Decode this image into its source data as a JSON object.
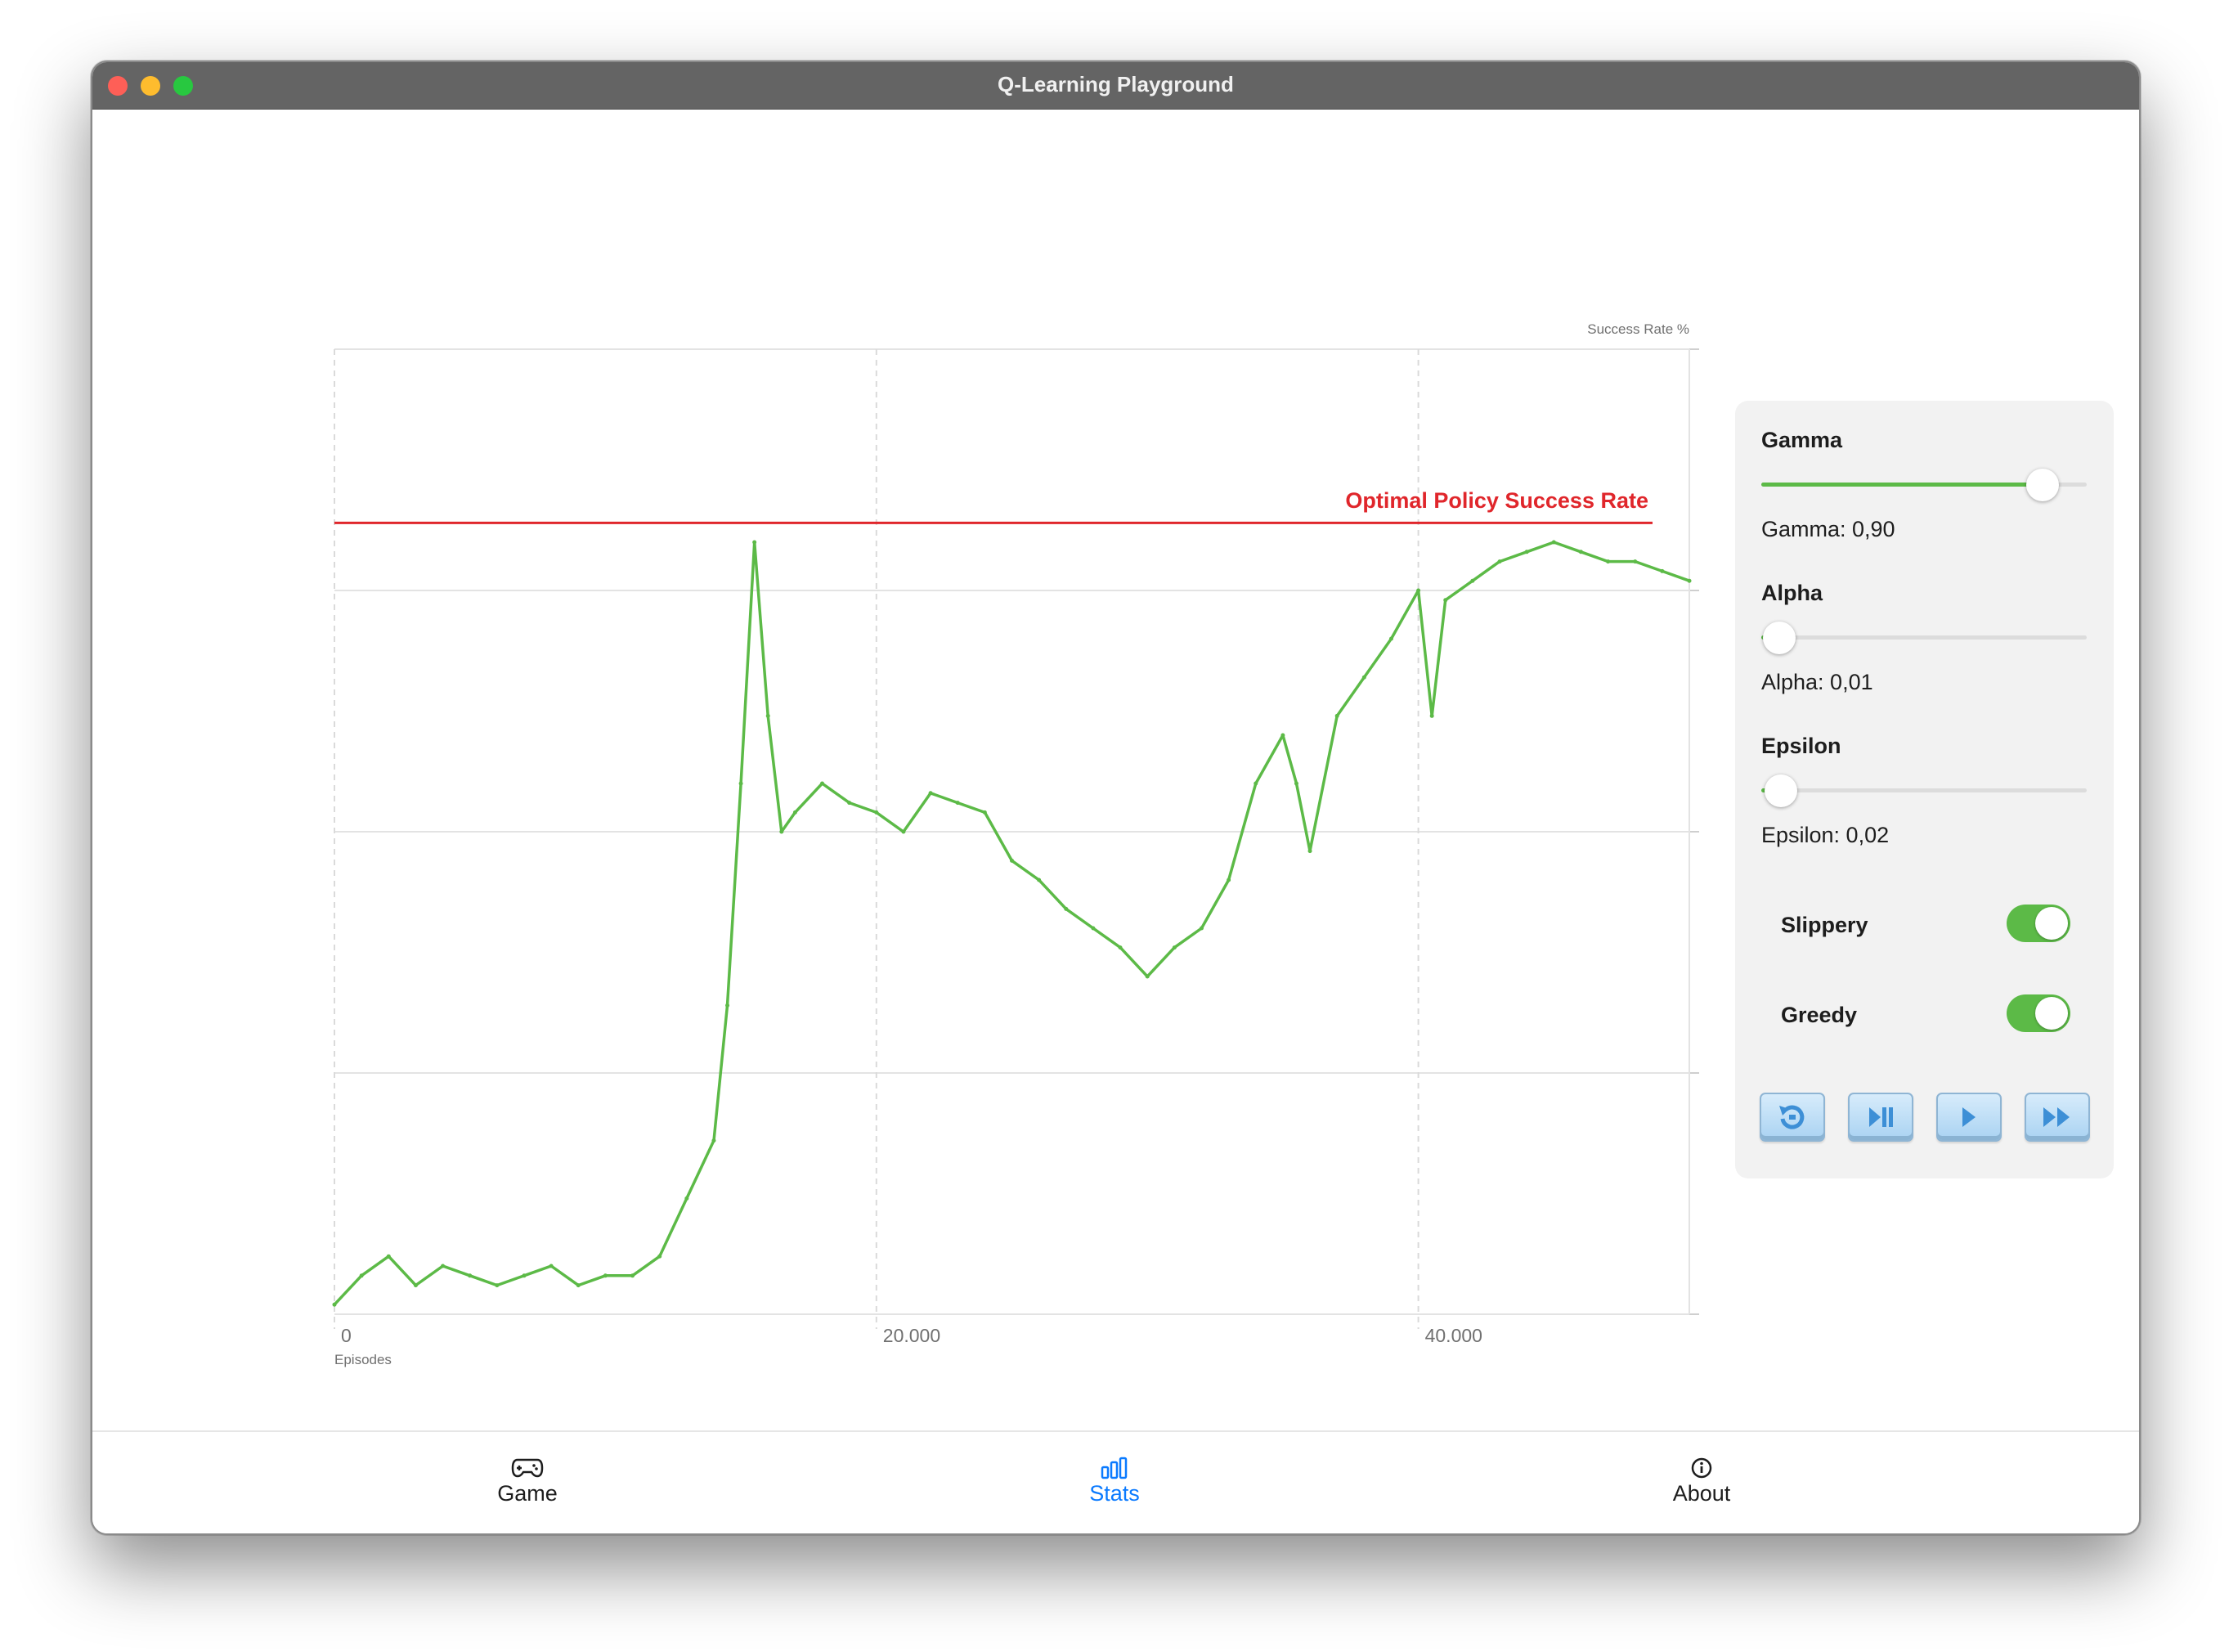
{
  "window": {
    "title": "Q-Learning Playground"
  },
  "chart_data": {
    "type": "line",
    "xlabel": "Episodes",
    "ylabel": "Success Rate %",
    "xlim": [
      0,
      50000
    ],
    "ylim": [
      0,
      100
    ],
    "x_ticks": [
      "0",
      "20.000",
      "40.000"
    ],
    "y_ticks": [
      "0",
      "25",
      "50",
      "75",
      "100"
    ],
    "grid": true,
    "reference_line": {
      "label": "Optimal Policy Success Rate",
      "y": 82,
      "color": "#e0262b"
    },
    "series": [
      {
        "color": "#5cba47",
        "x": [
          0,
          1000,
          2000,
          3000,
          4000,
          5000,
          6000,
          7000,
          8000,
          9000,
          10000,
          11000,
          12000,
          13000,
          14000,
          14500,
          15000,
          15500,
          16000,
          16500,
          17000,
          18000,
          19000,
          20000,
          21000,
          22000,
          23000,
          24000,
          25000,
          26000,
          27000,
          28000,
          29000,
          30000,
          31000,
          32000,
          33000,
          34000,
          35000,
          35500,
          36000,
          37000,
          38000,
          39000,
          40000,
          40500,
          41000,
          42000,
          43000,
          44000,
          45000,
          46000,
          47000,
          48000,
          49000,
          50000
        ],
        "y": [
          1,
          4,
          6,
          3,
          5,
          4,
          3,
          4,
          5,
          3,
          4,
          4,
          6,
          12,
          18,
          32,
          55,
          80,
          62,
          50,
          52,
          55,
          53,
          52,
          50,
          54,
          53,
          52,
          47,
          45,
          42,
          40,
          38,
          35,
          38,
          40,
          45,
          55,
          60,
          55,
          48,
          62,
          66,
          70,
          75,
          62,
          74,
          76,
          78,
          79,
          80,
          79,
          78,
          78,
          77,
          76
        ]
      }
    ]
  },
  "controls": {
    "gamma": {
      "title": "Gamma",
      "label": "Gamma: 0,90",
      "value": 0.9
    },
    "alpha": {
      "title": "Alpha",
      "label": "Alpha: 0,01",
      "value": 0.01
    },
    "epsilon": {
      "title": "Epsilon",
      "label": "Epsilon: 0,02",
      "value": 0.02
    },
    "slippery": {
      "label": "Slippery",
      "on": true
    },
    "greedy": {
      "label": "Greedy",
      "on": true
    },
    "buttons": [
      "reset-icon",
      "step-icon",
      "play-icon",
      "fast-forward-icon"
    ]
  },
  "tabs": [
    {
      "label": "Game",
      "icon": "gamecontroller-icon",
      "active": false
    },
    {
      "label": "Stats",
      "icon": "chart-bar-icon",
      "active": true
    },
    {
      "label": "About",
      "icon": "info-circle-icon",
      "active": false
    }
  ],
  "colors": {
    "accent": "#0a7aff",
    "series": "#5cba47",
    "reference": "#e0262b"
  }
}
